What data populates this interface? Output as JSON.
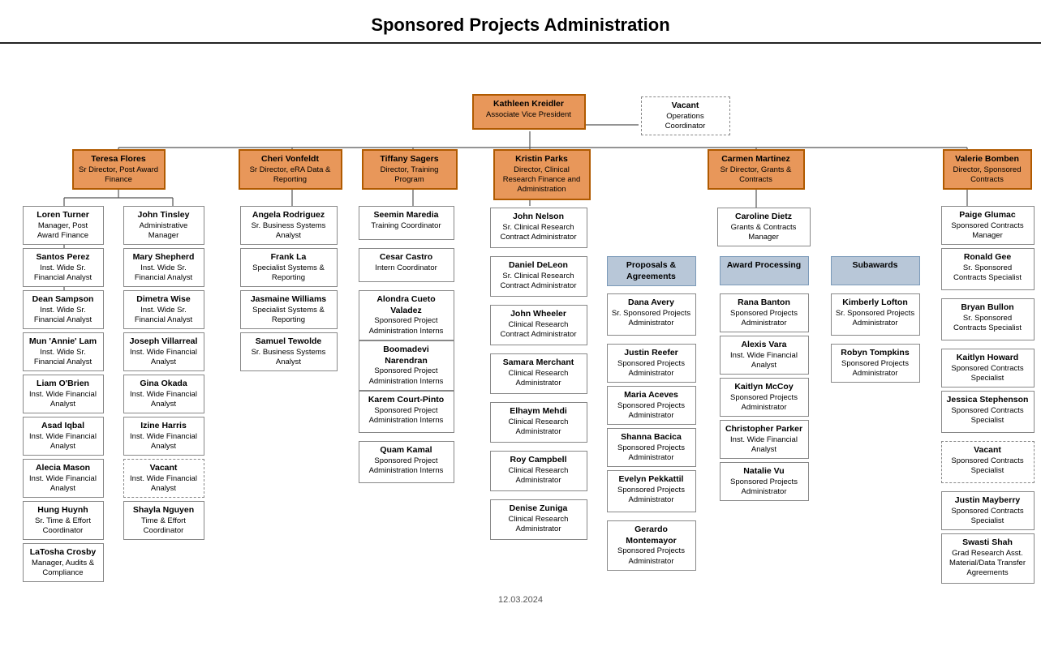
{
  "title": "Sponsored Projects Administration",
  "footer": "12.03.2024",
  "boxes": {
    "kathleen": {
      "name": "Kathleen Kreidler",
      "title": "Associate Vice President",
      "style": "orange"
    },
    "vacant_ops": {
      "name": "Vacant",
      "title": "Operations Coordinator",
      "style": "dashed"
    },
    "teresa": {
      "name": "Teresa Flores",
      "title": "Sr Director, Post Award Finance",
      "style": "orange"
    },
    "cheri": {
      "name": "Cheri Vonfeldt",
      "title": "Sr Director, eRA Data & Reporting",
      "style": "orange"
    },
    "tiffany": {
      "name": "Tiffany Sagers",
      "title": "Director, Training Program",
      "style": "orange"
    },
    "kristin": {
      "name": "Kristin Parks",
      "title": "Director, Clinical Research Finance and Administration",
      "style": "orange"
    },
    "carmen": {
      "name": "Carmen Martinez",
      "title": "Sr Director, Grants & Contracts",
      "style": "orange"
    },
    "valerie": {
      "name": "Valerie Bomben",
      "title": "Director, Sponsored Contracts",
      "style": "orange"
    },
    "loren": {
      "name": "Loren Turner",
      "title": "Manager, Post Award Finance",
      "style": "white"
    },
    "john_t": {
      "name": "John Tinsley",
      "title": "Administrative Manager",
      "style": "white"
    },
    "angela": {
      "name": "Angela Rodriguez",
      "title": "Sr. Business Systems Analyst",
      "style": "white"
    },
    "frank": {
      "name": "Frank La",
      "title": "Specialist Systems & Reporting",
      "style": "white"
    },
    "jasmaine": {
      "name": "Jasmaine Williams",
      "title": "Specialist Systems & Reporting",
      "style": "white"
    },
    "samuel": {
      "name": "Samuel Tewolde",
      "title": "Sr. Business Systems Analyst",
      "style": "white"
    },
    "seemin": {
      "name": "Seemin Maredia",
      "title": "Training Coordinator",
      "style": "white"
    },
    "cesar": {
      "name": "Cesar Castro",
      "title": "Intern Coordinator",
      "style": "white"
    },
    "alondra": {
      "name": "Alondra Cueto Valadez",
      "title": "Sponsored Project Administration Interns",
      "style": "white"
    },
    "boomadevi": {
      "name": "Boomadevi Narendran",
      "title": "Sponsored Project Administration Interns",
      "style": "white"
    },
    "karem": {
      "name": "Karem Court-Pinto",
      "title": "Sponsored Project Administration Interns",
      "style": "white"
    },
    "quam": {
      "name": "Quam Kamal",
      "title": "Sponsored Project Administration Interns",
      "style": "white"
    },
    "john_n": {
      "name": "John Nelson",
      "title": "Sr. Clinical Research Contract Administrator",
      "style": "white"
    },
    "daniel": {
      "name": "Daniel DeLeon",
      "title": "Sr. Clinical Research Contract Administrator",
      "style": "white"
    },
    "john_w": {
      "name": "John Wheeler",
      "title": "Clinical Research Contract Administrator",
      "style": "white"
    },
    "samara": {
      "name": "Samara Merchant",
      "title": "Clinical Research Administrator",
      "style": "white"
    },
    "elhaym": {
      "name": "Elhaym Mehdi",
      "title": "Clinical Research Administrator",
      "style": "white"
    },
    "roy": {
      "name": "Roy Campbell",
      "title": "Clinical Research Administrator",
      "style": "white"
    },
    "denise": {
      "name": "Denise Zuniga",
      "title": "Clinical Research Administrator",
      "style": "white"
    },
    "caroline": {
      "name": "Caroline Dietz",
      "title": "Grants & Contracts Manager",
      "style": "white"
    },
    "proposals": {
      "name": "Proposals & Agreements",
      "title": "",
      "style": "blue"
    },
    "award_processing": {
      "name": "Award Processing",
      "title": "",
      "style": "blue"
    },
    "subawards": {
      "name": "Subawards",
      "title": "",
      "style": "blue"
    },
    "dana": {
      "name": "Dana Avery",
      "title": "Sr. Sponsored Projects Administrator",
      "style": "white"
    },
    "justin_r": {
      "name": "Justin Reefer",
      "title": "Sponsored Projects Administrator",
      "style": "white"
    },
    "maria": {
      "name": "Maria Aceves",
      "title": "Sponsored Projects Administrator",
      "style": "white"
    },
    "shanna": {
      "name": "Shanna Bacica",
      "title": "Sponsored Projects Administrator",
      "style": "white"
    },
    "evelyn": {
      "name": "Evelyn Pekkattil",
      "title": "Sponsored Projects Administrator",
      "style": "white"
    },
    "gerardo": {
      "name": "Gerardo Montemayor",
      "title": "Sponsored Projects Administrator",
      "style": "white"
    },
    "rana": {
      "name": "Rana Banton",
      "title": "Sponsored Projects Administrator",
      "style": "white"
    },
    "alexis": {
      "name": "Alexis Vara",
      "title": "Inst. Wide Financial Analyst",
      "style": "white"
    },
    "kaitlyn": {
      "name": "Kaitlyn McCoy",
      "title": "Sponsored Projects Administrator",
      "style": "white"
    },
    "christopher": {
      "name": "Christopher Parker",
      "title": "Inst. Wide Financial Analyst",
      "style": "white"
    },
    "natalie": {
      "name": "Natalie Vu",
      "title": "Sponsored Projects Administrator",
      "style": "white"
    },
    "kimberly": {
      "name": "Kimberly Lofton",
      "title": "Sr. Sponsored Projects Administrator",
      "style": "white"
    },
    "robyn": {
      "name": "Robyn Tompkins",
      "title": "Sponsored Projects Administrator",
      "style": "white"
    },
    "paige": {
      "name": "Paige Glumac",
      "title": "Sponsored Contracts Manager",
      "style": "white"
    },
    "ronald": {
      "name": "Ronald Gee",
      "title": "Sr. Sponsored Contracts Specialist",
      "style": "white"
    },
    "bryan": {
      "name": "Bryan Bullon",
      "title": "Sr. Sponsored Contracts Specialist",
      "style": "white"
    },
    "kaitlyn_h": {
      "name": "Kaitlyn Howard",
      "title": "Sponsored Contracts Specialist",
      "style": "white"
    },
    "jessica": {
      "name": "Jessica Stephenson",
      "title": "Sponsored Contracts Specialist",
      "style": "white"
    },
    "vacant_scs": {
      "name": "Vacant",
      "title": "Sponsored Contracts Specialist",
      "style": "dashed"
    },
    "justin_m": {
      "name": "Justin Mayberry",
      "title": "Sponsored Contracts Specialist",
      "style": "white"
    },
    "swasti": {
      "name": "Swasti Shah",
      "title": "Grad Research Asst. Material/Data Transfer Agreements",
      "style": "white"
    },
    "santos": {
      "name": "Santos Perez",
      "title": "Inst. Wide Sr. Financial Analyst",
      "style": "white"
    },
    "dean": {
      "name": "Dean Sampson",
      "title": "Inst. Wide Sr. Financial Analyst",
      "style": "white"
    },
    "mun": {
      "name": "Mun 'Annie' Lam",
      "title": "Inst. Wide Sr. Financial Analyst",
      "style": "white"
    },
    "liam": {
      "name": "Liam O'Brien",
      "title": "Inst. Wide Financial Analyst",
      "style": "white"
    },
    "asad": {
      "name": "Asad Iqbal",
      "title": "Inst. Wide Financial Analyst",
      "style": "white"
    },
    "alecia": {
      "name": "Alecia Mason",
      "title": "Inst. Wide Financial Analyst",
      "style": "white"
    },
    "hung": {
      "name": "Hung Huynh",
      "title": "Sr. Time & Effort Coordinator",
      "style": "white"
    },
    "latosha": {
      "name": "LaTosha Crosby",
      "title": "Manager, Audits & Compliance",
      "style": "white"
    },
    "mary": {
      "name": "Mary Shepherd",
      "title": "Inst. Wide Sr. Financial Analyst",
      "style": "white"
    },
    "dimetra": {
      "name": "Dimetra Wise",
      "title": "Inst. Wide Sr. Financial Analyst",
      "style": "white"
    },
    "joseph": {
      "name": "Joseph Villarreal",
      "title": "Inst. Wide Financial Analyst",
      "style": "white"
    },
    "gina": {
      "name": "Gina Okada",
      "title": "Inst. Wide Financial Analyst",
      "style": "white"
    },
    "izine": {
      "name": "Izine Harris",
      "title": "Inst. Wide Financial Analyst",
      "style": "white"
    },
    "vacant_fa": {
      "name": "Vacant",
      "title": "Inst. Wide Financial Analyst",
      "style": "dashed"
    },
    "shayla": {
      "name": "Shayla Nguyen",
      "title": "Time & Effort Coordinator",
      "style": "white"
    }
  }
}
